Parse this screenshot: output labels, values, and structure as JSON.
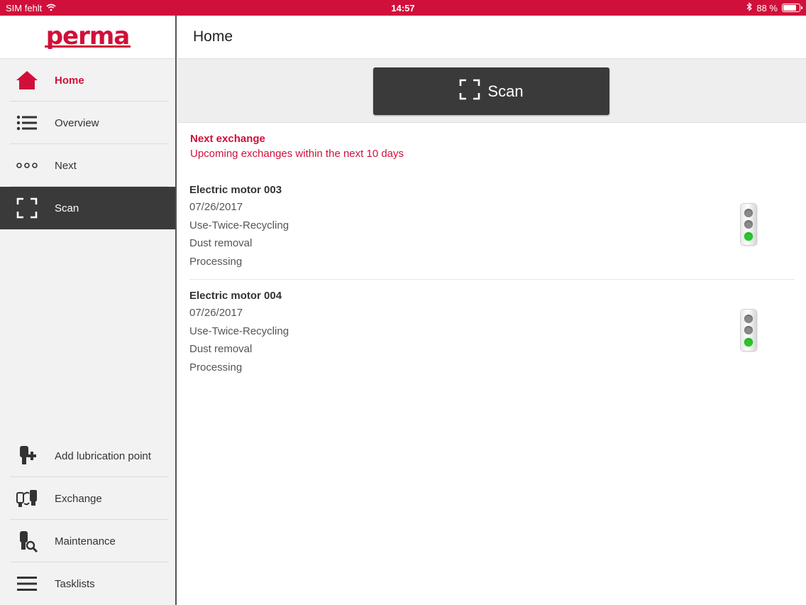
{
  "status_bar": {
    "carrier": "SIM fehlt",
    "time": "14:57",
    "battery": "88 %",
    "battery_level": 0.88,
    "wifi_icon": "wifi-icon",
    "bluetooth_icon": "bluetooth-icon"
  },
  "brand": {
    "logo_text": "perma",
    "color": "#d0103a"
  },
  "sidebar": {
    "items": [
      {
        "label": "Home",
        "icon": "home-icon"
      },
      {
        "label": "Overview",
        "icon": "list-icon"
      },
      {
        "label": "Next",
        "icon": "dots-icon"
      },
      {
        "label": "Scan",
        "icon": "scan-icon"
      }
    ],
    "bottom_items": [
      {
        "label": "Add lubrication point",
        "icon": "add-lubricator-icon"
      },
      {
        "label": "Exchange",
        "icon": "exchange-icon"
      },
      {
        "label": "Maintenance",
        "icon": "maintenance-icon"
      },
      {
        "label": "Tasklists",
        "icon": "menu-icon"
      }
    ]
  },
  "main": {
    "title": "Home",
    "scan_button_label": "Scan",
    "section_title": "Next exchange",
    "section_subtitle": "Upcoming exchanges within the next 10 days",
    "items": [
      {
        "name": "Electric motor 003",
        "date": "07/26/2017",
        "lubricator": "Use-Twice-Recycling",
        "location": "Dust removal",
        "status": "Processing",
        "traffic_light": "green"
      },
      {
        "name": "Electric motor 004",
        "date": "07/26/2017",
        "lubricator": "Use-Twice-Recycling",
        "location": "Dust removal",
        "status": "Processing",
        "traffic_light": "green"
      }
    ]
  }
}
